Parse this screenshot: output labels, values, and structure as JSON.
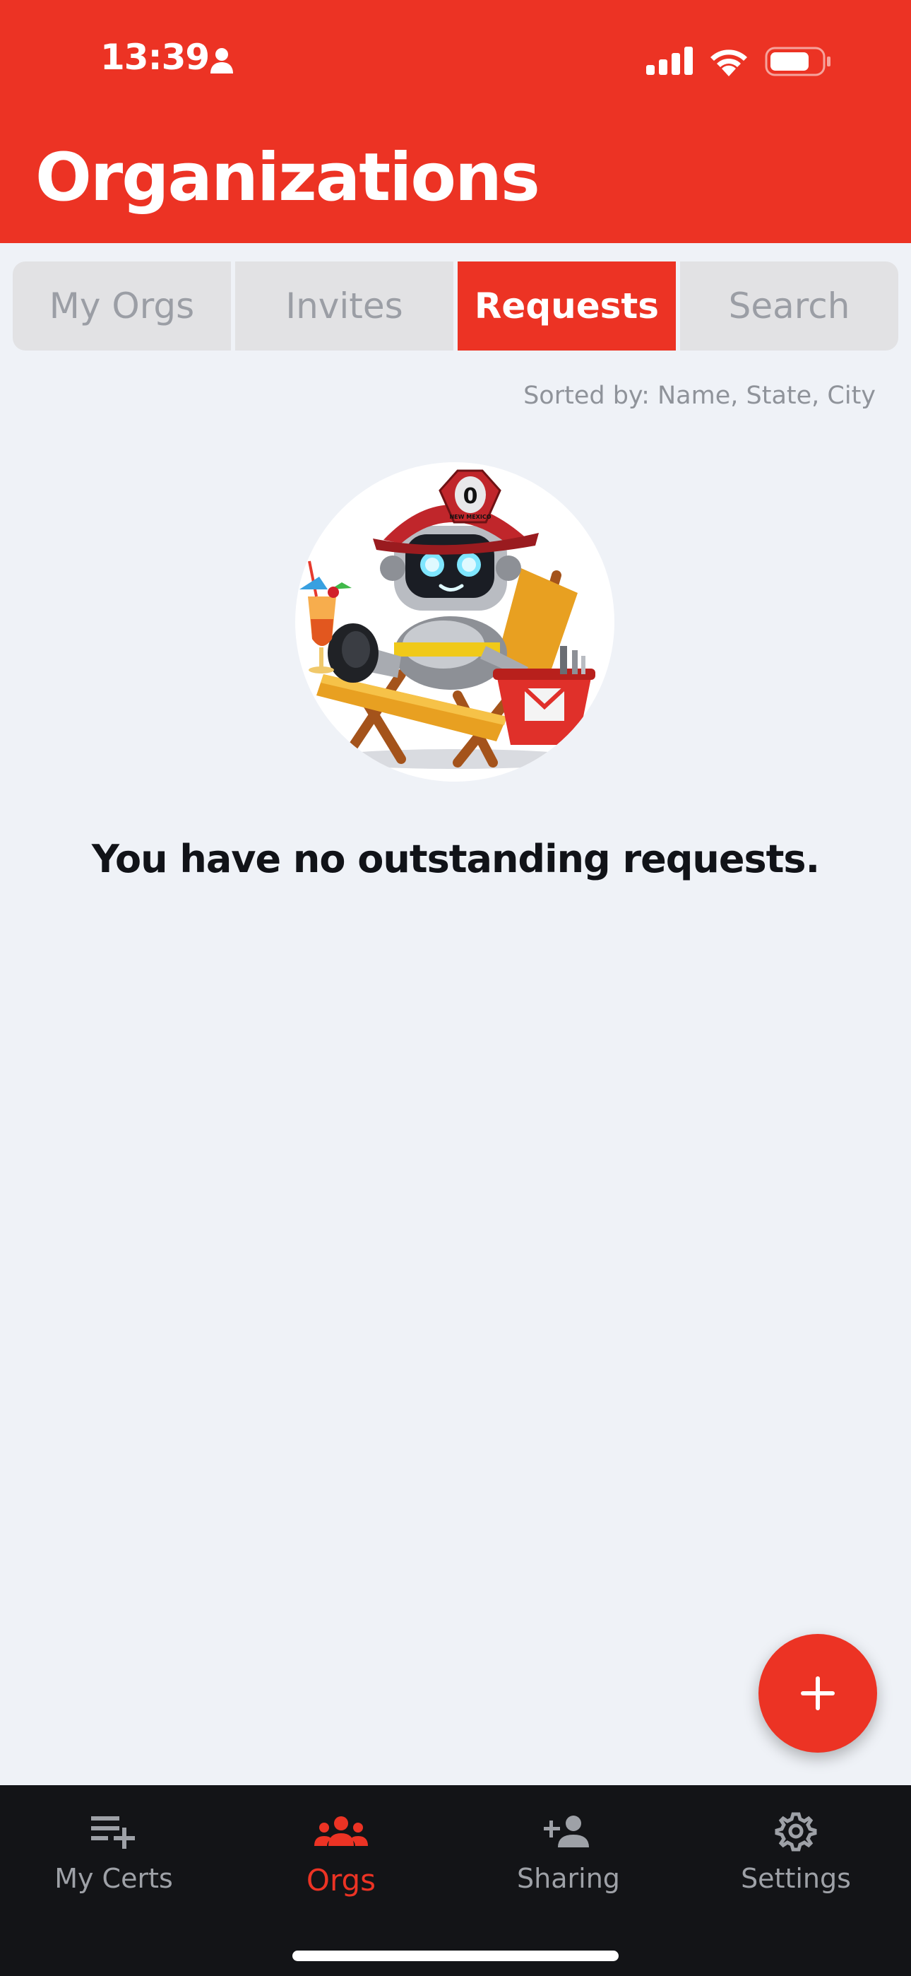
{
  "status_bar": {
    "time": "13:39"
  },
  "header": {
    "title": "Organizations"
  },
  "tabs": [
    {
      "label": "My Orgs",
      "active": false
    },
    {
      "label": "Invites",
      "active": false
    },
    {
      "label": "Requests",
      "active": true
    },
    {
      "label": "Search",
      "active": false
    }
  ],
  "sort_label": "Sorted by: Name, State, City",
  "mascot": {
    "helmet_badge": "0",
    "helmet_text": "NEW MEXICO"
  },
  "empty_message": "You have no outstanding requests.",
  "fab": {
    "icon": "plus-icon"
  },
  "bottom_nav": [
    {
      "label": "My Certs",
      "icon": "playlist-add-icon",
      "active": false
    },
    {
      "label": "Orgs",
      "icon": "people-icon",
      "active": true
    },
    {
      "label": "Sharing",
      "icon": "person-add-icon",
      "active": false
    },
    {
      "label": "Settings",
      "icon": "gear-icon",
      "active": false
    }
  ],
  "colors": {
    "accent": "#ec3324",
    "background": "#eff2f7",
    "nav_background": "#131417",
    "tab_inactive": "#e2e2e4"
  }
}
